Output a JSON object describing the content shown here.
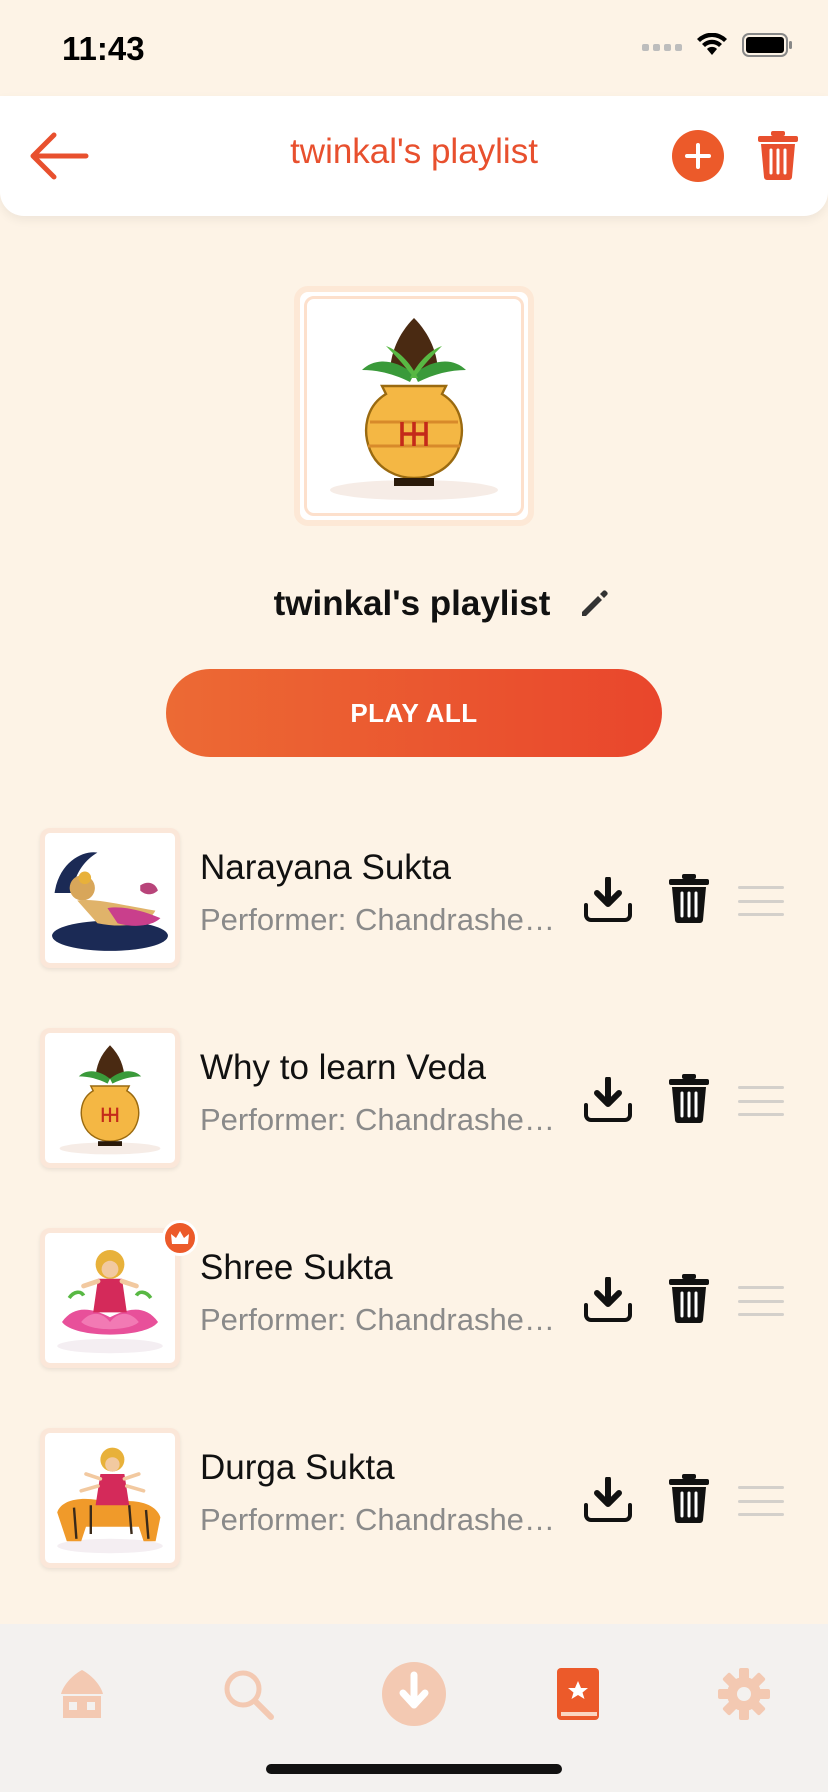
{
  "status_bar": {
    "time": "11:43"
  },
  "header": {
    "title": "twinkal's playlist"
  },
  "playlist": {
    "name": "twinkal's playlist",
    "play_all_label": "PLAY ALL"
  },
  "tracks": [
    {
      "title": "Narayana Sukta",
      "performer": "Performer: Chandrashekhar Ghanapathi",
      "premium": false,
      "art": "vishnu-art"
    },
    {
      "title": "Why to learn Veda",
      "performer": "Performer: Chandrashekhar Ghanapathi",
      "premium": false,
      "art": "kalash-art"
    },
    {
      "title": "Shree Sukta",
      "performer": "Performer: Chandrashekhar Ghanapathi",
      "premium": true,
      "art": "lakshmi-art"
    },
    {
      "title": "Durga Sukta",
      "performer": "Performer: Chandrashekhar Ghanapathi",
      "premium": false,
      "art": "durga-art"
    }
  ],
  "tab_bar": {
    "tabs": [
      {
        "name": "home",
        "icon": "home-icon",
        "active": false
      },
      {
        "name": "search",
        "icon": "search-icon",
        "active": false
      },
      {
        "name": "downloads",
        "icon": "download-icon",
        "active": false
      },
      {
        "name": "library",
        "icon": "library-book-icon",
        "active": true
      },
      {
        "name": "settings",
        "icon": "gear-icon",
        "active": false
      }
    ]
  },
  "colors": {
    "accent": "#ec5a2a",
    "background": "#fdf3e6",
    "header_title": "#e8502e",
    "tab_inactive": "#f3c9b2",
    "secondary_text": "#8a8a8a"
  }
}
